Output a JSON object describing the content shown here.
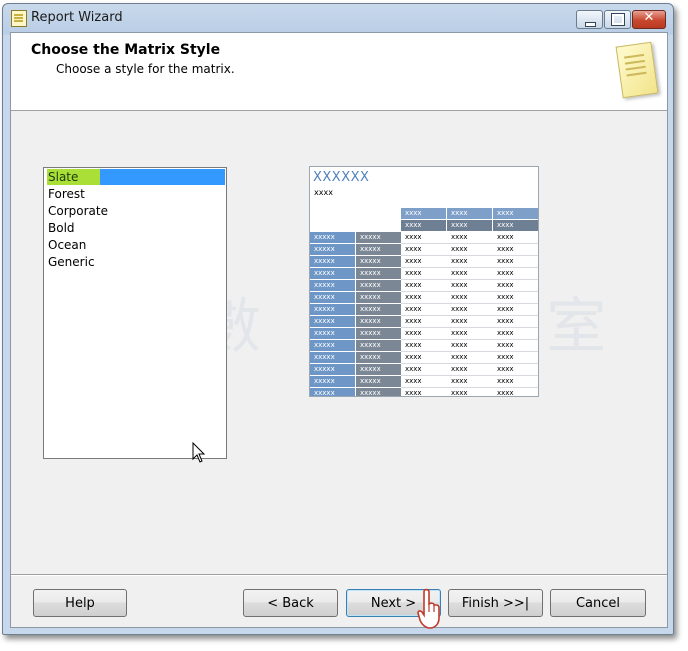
{
  "window": {
    "title": "Report Wizard"
  },
  "header": {
    "title": "Choose the Matrix Style",
    "subtitle": "Choose a style for the matrix."
  },
  "styles": {
    "items": [
      {
        "label": "Slate",
        "selected": true
      },
      {
        "label": "Forest",
        "selected": false
      },
      {
        "label": "Corporate",
        "selected": false
      },
      {
        "label": "Bold",
        "selected": false
      },
      {
        "label": "Ocean",
        "selected": false
      },
      {
        "label": "Generic",
        "selected": false
      }
    ]
  },
  "preview": {
    "title": "XXXXXX",
    "subtitle": "xxxx",
    "col_header_text": "xxxx",
    "row_header_text": "xxxxx",
    "cell_text": "xxxx",
    "colors": {
      "title": "#4f81bd",
      "header_light": "#7e9fc8",
      "header_slate": "#6e7e93",
      "row_blue": "#6e97c7",
      "row_slate": "#7c8796"
    }
  },
  "buttons": {
    "help": "Help",
    "back": "< Back",
    "next": "Next >",
    "finish": "Finish >>|",
    "cancel": "Cancel"
  },
  "watermark": "數 據 庫 室"
}
